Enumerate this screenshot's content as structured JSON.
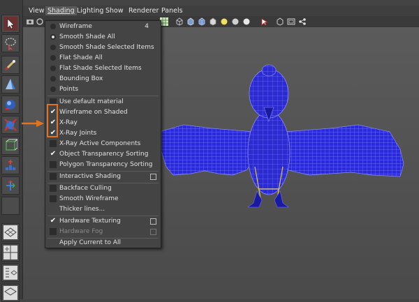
{
  "menubar": {
    "items": [
      {
        "label": "View",
        "active": false
      },
      {
        "label": "Shading",
        "active": true
      },
      {
        "label": "Lighting",
        "active": false
      },
      {
        "label": "Show",
        "active": false
      },
      {
        "label": "Renderer",
        "active": false
      },
      {
        "label": "Panels",
        "active": false
      }
    ]
  },
  "dropdown": {
    "items": [
      {
        "label": "Wireframe",
        "kind": "radio",
        "selected": false,
        "shortcut": "4"
      },
      {
        "label": "Smooth Shade All",
        "kind": "radio",
        "selected": true
      },
      {
        "label": "Smooth Shade Selected Items",
        "kind": "radio",
        "selected": false
      },
      {
        "label": "Flat Shade All",
        "kind": "radio",
        "selected": false
      },
      {
        "label": "Flat Shade Selected Items",
        "kind": "radio",
        "selected": false
      },
      {
        "label": "Bounding Box",
        "kind": "radio",
        "selected": false
      },
      {
        "label": "Points",
        "kind": "radio",
        "selected": false
      },
      {
        "label": "Use default material",
        "kind": "check",
        "checked": false
      },
      {
        "label": "Wireframe on Shaded",
        "kind": "check",
        "checked": true
      },
      {
        "label": "X-Ray",
        "kind": "check",
        "checked": true
      },
      {
        "label": "X-Ray Joints",
        "kind": "check",
        "checked": true
      },
      {
        "label": "X-Ray Active Components",
        "kind": "check",
        "checked": false
      },
      {
        "label": "Object Transparency Sorting",
        "kind": "check",
        "checked": true
      },
      {
        "label": "Polygon Transparency Sorting",
        "kind": "check",
        "checked": false
      },
      {
        "label": "Interactive Shading",
        "kind": "check",
        "checked": false,
        "option_box": true
      },
      {
        "label": "Backface Culling",
        "kind": "check",
        "checked": false
      },
      {
        "label": "Smooth Wireframe",
        "kind": "check",
        "checked": false
      },
      {
        "label": "Thicker lines...",
        "kind": "plain"
      },
      {
        "label": "Hardware Texturing",
        "kind": "check",
        "checked": true,
        "option_box": true
      },
      {
        "label": "Hardware Fog",
        "kind": "check",
        "checked": false,
        "option_box": true,
        "disabled": true
      },
      {
        "label": "Apply Current to All",
        "kind": "plain"
      }
    ]
  },
  "toolbox": {
    "tools": [
      "select-tool-icon",
      "lasso-tool-icon",
      "paint-select-tool-icon",
      "move-tool-icon",
      "rotate-tool-icon",
      "scale-tool-icon",
      "manipulator-tool-icon",
      "soft-mod-tool-icon",
      "last-tool-icon",
      "empty-tool-slot"
    ],
    "layouts": [
      "single-view-layout-icon",
      "four-view-layout-icon",
      "outliner-layout-icon",
      "persp-graph-layout-icon"
    ]
  },
  "colors": {
    "highlight": "#e3741f",
    "wire": "#2a2ad8",
    "joints": "#e0c85a"
  }
}
